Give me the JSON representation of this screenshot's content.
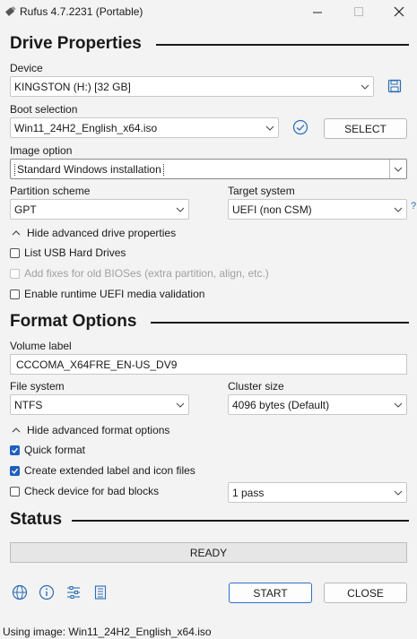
{
  "window": {
    "title": "Rufus 4.7.2231 (Portable)"
  },
  "drive_properties": {
    "heading": "Drive Properties",
    "device_label": "Device",
    "device_value": "KINGSTON (H:) [32 GB]",
    "boot_selection_label": "Boot selection",
    "boot_selection_value": "Win11_24H2_English_x64.iso",
    "select_button": "SELECT",
    "image_option_label": "Image option",
    "image_option_value": "Standard Windows installation",
    "partition_scheme_label": "Partition scheme",
    "partition_scheme_value": "GPT",
    "target_system_label": "Target system",
    "target_system_value": "UEFI (non CSM)",
    "help_mark": "?",
    "advanced_toggle": "Hide advanced drive properties",
    "list_usb": "List USB Hard Drives",
    "fixes_bios": "Add fixes for old BIOSes (extra partition, align, etc.)",
    "uefi_validation": "Enable runtime UEFI media validation"
  },
  "format_options": {
    "heading": "Format Options",
    "volume_label_label": "Volume label",
    "volume_label_value": "CCCOMA_X64FRE_EN-US_DV9",
    "file_system_label": "File system",
    "file_system_value": "NTFS",
    "cluster_size_label": "Cluster size",
    "cluster_size_value": "4096 bytes (Default)",
    "advanced_toggle": "Hide advanced format options",
    "quick_format": "Quick format",
    "extended_label": "Create extended label and icon files",
    "bad_blocks": "Check device for bad blocks",
    "passes_value": "1 pass"
  },
  "checkboxes": {
    "list_usb": false,
    "fixes_bios": false,
    "uefi_validation": false,
    "quick_format": true,
    "extended_label": true,
    "bad_blocks": false
  },
  "status": {
    "heading": "Status",
    "progress_text": "READY",
    "progress_fraction": 0
  },
  "actions": {
    "start": "START",
    "close": "CLOSE"
  },
  "footer": {
    "status_text": "Using image: Win11_24H2_English_x64.iso"
  },
  "icons": {
    "app": "usb-drive-icon",
    "save": "floppy-disk-icon",
    "verify": "check-circle-icon",
    "language": "globe-icon",
    "about": "info-icon",
    "settings": "sliders-icon",
    "log": "log-icon"
  },
  "colors": {
    "accent": "#1f5fbf",
    "background": "#f3f3f3"
  }
}
